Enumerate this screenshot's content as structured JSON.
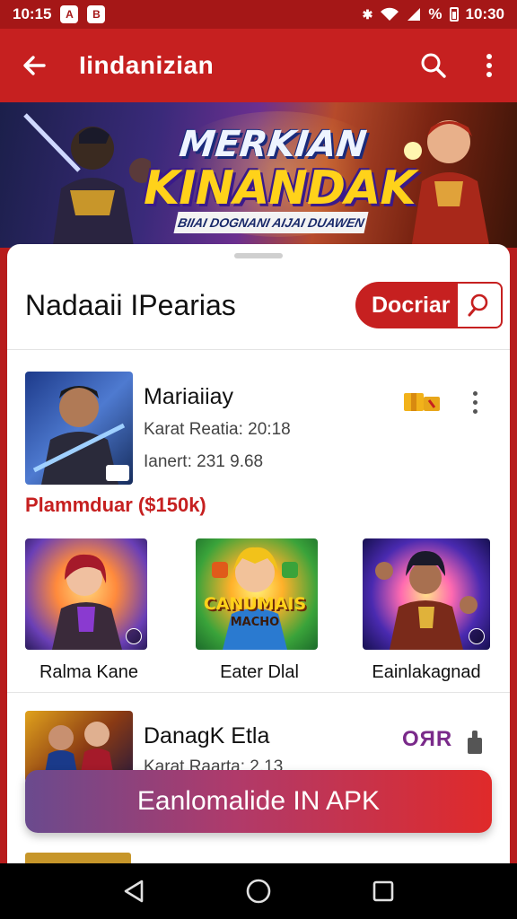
{
  "status_bar": {
    "time": "10:15",
    "app_icon_1": "A",
    "app_icon_2": "B",
    "battery_text": "%",
    "right_time": "10:30"
  },
  "app_bar": {
    "title": "Iindanizian",
    "icons": [
      "back-arrow-icon",
      "search-icon",
      "more-vert-icon"
    ]
  },
  "banner": {
    "title_line1": "MERKIAN",
    "title_line2": "KINANDAK",
    "subtitle": "BIIAI DOGNANI AIJAI DUAWEN"
  },
  "section": {
    "title": "Nadaaii IPearias",
    "cta_label": "Docriar"
  },
  "items": [
    {
      "name": "Mariaiiay",
      "meta_1": "Karat Reatia: 20:18",
      "meta_2": "Ianert: 231 9.68"
    },
    {
      "name": "DanagK Etla",
      "meta_1": "Karat Raarta: 2.13",
      "status": "OЯR"
    }
  ],
  "promo_text": "Plammduar ($150k)",
  "grid": [
    {
      "label": "Ralma Kane"
    },
    {
      "label": "Eater Dlal",
      "art_text_1": "CANUMAIS",
      "art_text_2": "MACHO"
    },
    {
      "label": "Eainlakagnad"
    }
  ],
  "download_button": "Eanlomalide IN APK",
  "colors": {
    "primary": "#c62020",
    "status_bar": "#a51717",
    "promo": "#c62020",
    "accent_purple": "#7a2a8a"
  }
}
